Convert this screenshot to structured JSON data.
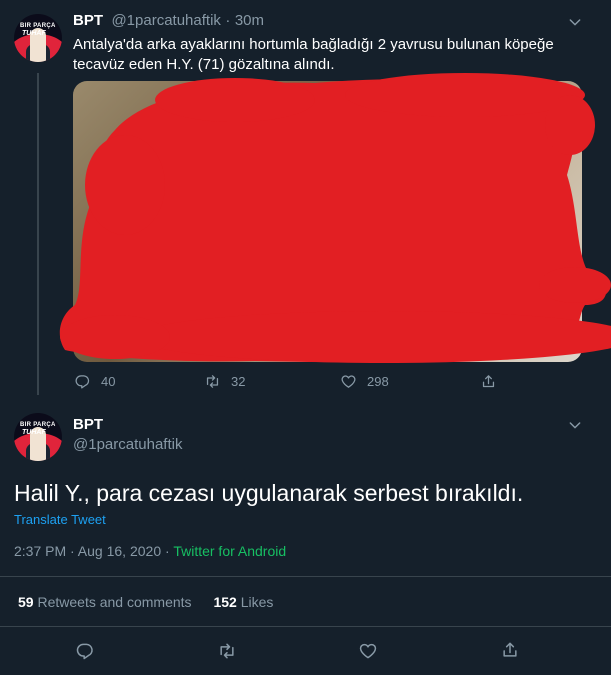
{
  "tweet1": {
    "name": "BPT",
    "handle": "@1parcatuhaftik",
    "separator": "·",
    "time": "30m",
    "text_line1": "Antalya'da arka ayaklarını hortumla bağladığı 2 yavrusu bulunan köpeğe",
    "text_line2": "tecavüz eden H.Y. (71) gözaltına alındı.",
    "replies": "40",
    "retweets": "32",
    "likes": "298"
  },
  "tweet2": {
    "name": "BPT",
    "handle": "@1parcatuhaftik",
    "text": "Halil Y., para cezası uygulanarak serbest bırakıldı.",
    "translate": "Translate Tweet",
    "time": "2:37 PM · Aug 16, 2020",
    "dot": " · ",
    "source": "Twitter for Android",
    "retweet_count": "59",
    "retweet_label": "Retweets and comments",
    "like_count": "152",
    "like_label": "Likes"
  },
  "avatar": {
    "line1": "BIR PARÇA",
    "line2": "TUHAF"
  },
  "colors": {
    "background": "#15202b",
    "muted": "#8899a6",
    "accent": "#1da1f2",
    "source": "#17bf63",
    "redaction": "#e21f23"
  },
  "icons": [
    "chevron-down-icon",
    "reply-icon",
    "retweet-icon",
    "like-icon",
    "share-icon"
  ]
}
